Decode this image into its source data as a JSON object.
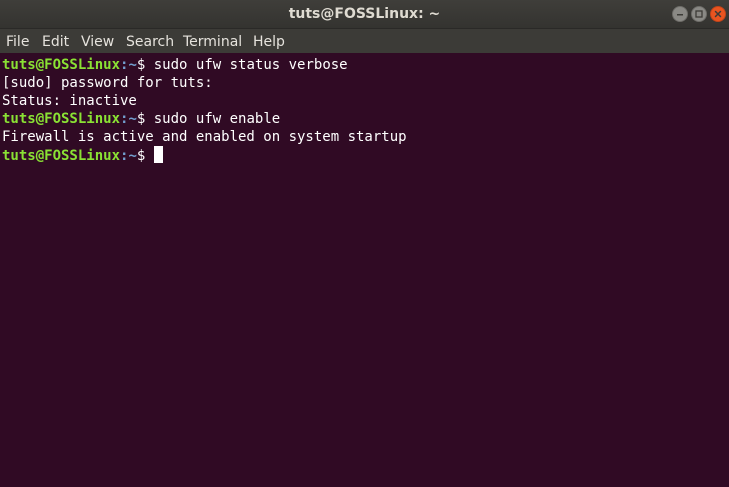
{
  "window": {
    "title": "tuts@FOSSLinux: ~"
  },
  "menubar": {
    "items": [
      "File",
      "Edit",
      "View",
      "Search",
      "Terminal",
      "Help"
    ]
  },
  "terminal": {
    "prompt_user": "tuts@FOSSLinux",
    "prompt_path": ":~",
    "prompt_symbol": "$",
    "lines": [
      {
        "type": "command",
        "text": " sudo ufw status verbose"
      },
      {
        "type": "output",
        "text": "[sudo] password for tuts:"
      },
      {
        "type": "output",
        "text": "Status: inactive"
      },
      {
        "type": "command",
        "text": " sudo ufw enable"
      },
      {
        "type": "output",
        "text": "Firewall is active and enabled on system startup"
      },
      {
        "type": "prompt",
        "text": ""
      }
    ]
  },
  "colors": {
    "background": "#300a24",
    "prompt_user": "#8ae234",
    "prompt_path": "#729fcf",
    "text": "#ffffff",
    "close_button": "#e95420"
  },
  "icons": {
    "minimize": "minimize-icon",
    "maximize": "maximize-icon",
    "close": "close-icon"
  }
}
